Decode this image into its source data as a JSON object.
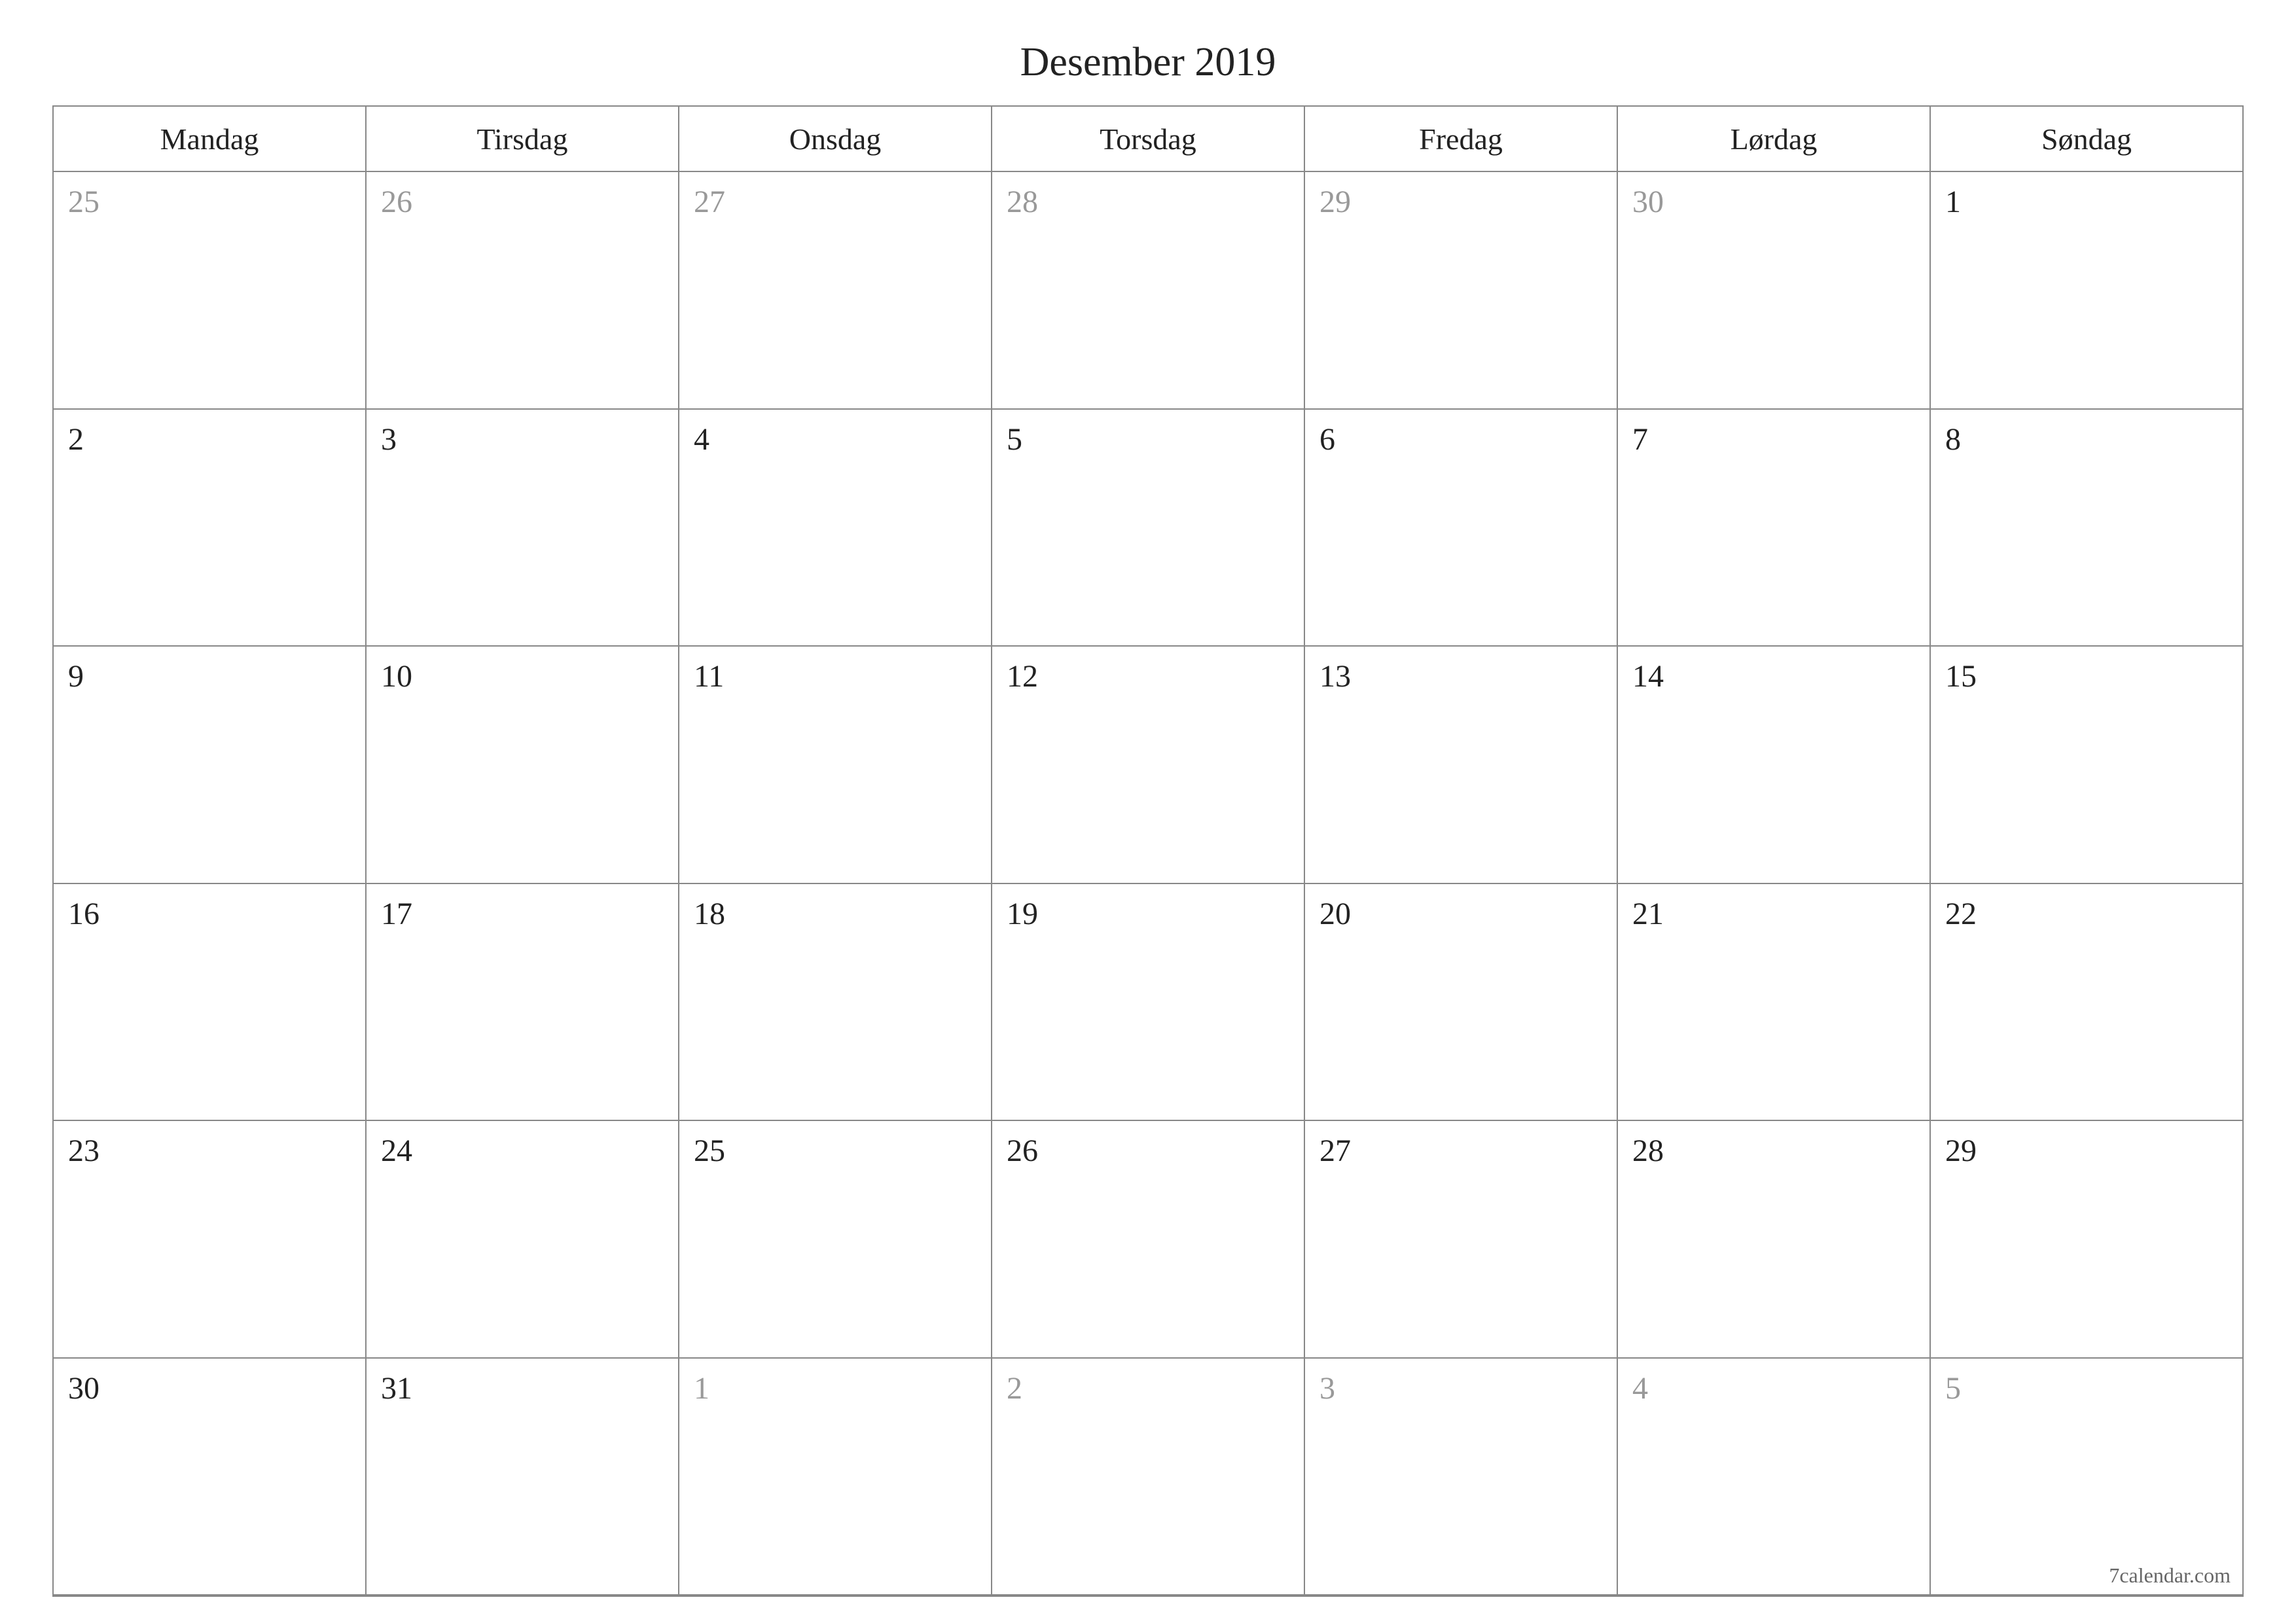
{
  "title": "Desember 2019",
  "daysOfWeek": [
    "Mandag",
    "Tirsdag",
    "Onsdag",
    "Torsdag",
    "Fredag",
    "Lørdag",
    "Søndag"
  ],
  "weeks": [
    [
      {
        "day": "25",
        "otherMonth": true
      },
      {
        "day": "26",
        "otherMonth": true
      },
      {
        "day": "27",
        "otherMonth": true
      },
      {
        "day": "28",
        "otherMonth": true
      },
      {
        "day": "29",
        "otherMonth": true
      },
      {
        "day": "30",
        "otherMonth": true
      },
      {
        "day": "1",
        "otherMonth": false
      }
    ],
    [
      {
        "day": "2",
        "otherMonth": false
      },
      {
        "day": "3",
        "otherMonth": false
      },
      {
        "day": "4",
        "otherMonth": false
      },
      {
        "day": "5",
        "otherMonth": false
      },
      {
        "day": "6",
        "otherMonth": false
      },
      {
        "day": "7",
        "otherMonth": false
      },
      {
        "day": "8",
        "otherMonth": false
      }
    ],
    [
      {
        "day": "9",
        "otherMonth": false
      },
      {
        "day": "10",
        "otherMonth": false
      },
      {
        "day": "11",
        "otherMonth": false
      },
      {
        "day": "12",
        "otherMonth": false
      },
      {
        "day": "13",
        "otherMonth": false
      },
      {
        "day": "14",
        "otherMonth": false
      },
      {
        "day": "15",
        "otherMonth": false
      }
    ],
    [
      {
        "day": "16",
        "otherMonth": false
      },
      {
        "day": "17",
        "otherMonth": false
      },
      {
        "day": "18",
        "otherMonth": false
      },
      {
        "day": "19",
        "otherMonth": false
      },
      {
        "day": "20",
        "otherMonth": false
      },
      {
        "day": "21",
        "otherMonth": false
      },
      {
        "day": "22",
        "otherMonth": false
      }
    ],
    [
      {
        "day": "23",
        "otherMonth": false
      },
      {
        "day": "24",
        "otherMonth": false
      },
      {
        "day": "25",
        "otherMonth": false
      },
      {
        "day": "26",
        "otherMonth": false
      },
      {
        "day": "27",
        "otherMonth": false
      },
      {
        "day": "28",
        "otherMonth": false
      },
      {
        "day": "29",
        "otherMonth": false
      }
    ],
    [
      {
        "day": "30",
        "otherMonth": false
      },
      {
        "day": "31",
        "otherMonth": false
      },
      {
        "day": "1",
        "otherMonth": true
      },
      {
        "day": "2",
        "otherMonth": true
      },
      {
        "day": "3",
        "otherMonth": true
      },
      {
        "day": "4",
        "otherMonth": true
      },
      {
        "day": "5",
        "otherMonth": true
      }
    ]
  ],
  "footer": "7calendar.com"
}
